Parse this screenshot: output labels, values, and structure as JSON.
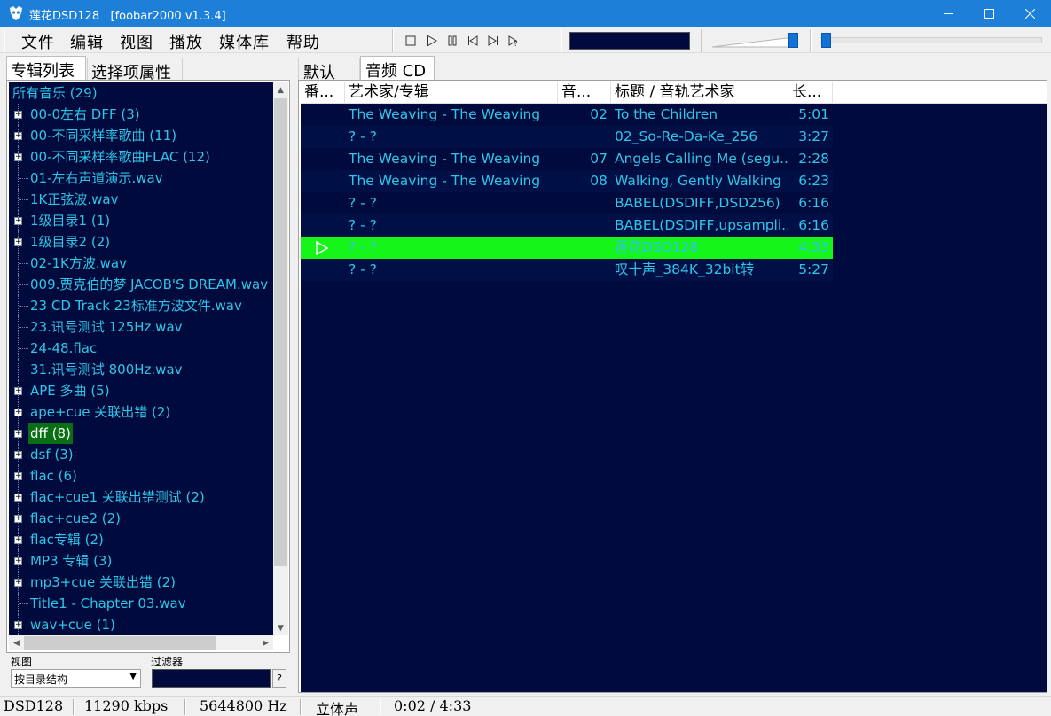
{
  "window": {
    "app_name": "莲花DSD128",
    "app_version": "[foobar2000 v1.3.4]",
    "colors": {
      "titlebar": "#1e7fd9",
      "panel_bg": "#000a3c",
      "text": "#2ec5e8",
      "playing_row": "#16f51a",
      "selected_tree": "#0a6e14"
    }
  },
  "menu": {
    "items": [
      "文件",
      "编辑",
      "视图",
      "播放",
      "媒体库",
      "帮助"
    ]
  },
  "toolbar": {
    "buttons": [
      "stop-icon",
      "play-icon",
      "pause-icon",
      "previous-icon",
      "next-icon",
      "random-icon"
    ]
  },
  "volume": {
    "level": 0.9
  },
  "seek": {
    "position": 0.008
  },
  "left_tabs": [
    "专辑列表",
    "选择项属性"
  ],
  "tree": {
    "root": "所有音乐 (29)",
    "items": [
      {
        "label": "00-0左右 DFF (3)",
        "expandable": true
      },
      {
        "label": "00-不同采样率歌曲 (11)",
        "expandable": true
      },
      {
        "label": "00-不同采样率歌曲FLAC (12)",
        "expandable": true
      },
      {
        "label": "01-左右声道演示.wav",
        "expandable": false
      },
      {
        "label": "1K正弦波.wav",
        "expandable": false
      },
      {
        "label": "1级目录1 (1)",
        "expandable": true
      },
      {
        "label": "1级目录2 (2)",
        "expandable": true
      },
      {
        "label": "02-1K方波.wav",
        "expandable": false
      },
      {
        "label": "009.贾克伯的梦 JACOB'S DREAM.wav",
        "expandable": false
      },
      {
        "label": "23 CD Track 23标准方波文件.wav",
        "expandable": false
      },
      {
        "label": "23.讯号测试 125Hz.wav",
        "expandable": false
      },
      {
        "label": "24-48.flac",
        "expandable": false
      },
      {
        "label": "31.讯号测试 800Hz.wav",
        "expandable": false
      },
      {
        "label": "APE 多曲 (5)",
        "expandable": true
      },
      {
        "label": "ape+cue 关联出错 (2)",
        "expandable": true
      },
      {
        "label": "dff (8)",
        "expandable": true,
        "selected": true
      },
      {
        "label": "dsf (3)",
        "expandable": true
      },
      {
        "label": "flac (6)",
        "expandable": true
      },
      {
        "label": "flac+cue1 关联出错测试 (2)",
        "expandable": true
      },
      {
        "label": "flac+cue2 (2)",
        "expandable": true
      },
      {
        "label": "flac专辑 (2)",
        "expandable": true
      },
      {
        "label": "MP3 专辑 (3)",
        "expandable": true
      },
      {
        "label": "mp3+cue 关联出错 (2)",
        "expandable": true
      },
      {
        "label": "Title1 - Chapter 03.wav",
        "expandable": false
      },
      {
        "label": "wav+cue (1)",
        "expandable": true
      }
    ]
  },
  "view": {
    "label": "视图",
    "selected": "按目录结构"
  },
  "filter": {
    "label": "过滤器",
    "help": "?"
  },
  "right_tabs": [
    "默认",
    "音频 CD"
  ],
  "playlist": {
    "columns": [
      "番...",
      "艺术家/专辑",
      "音...",
      "标题 / 音轨艺术家",
      "长..."
    ],
    "rows": [
      {
        "artist_album": "The Weaving - The Weaving",
        "track": "02",
        "title": "To the Children",
        "length": "5:01"
      },
      {
        "artist_album": "? - ?",
        "track": "",
        "title": "02_So-Re-Da-Ke_256",
        "length": "3:27"
      },
      {
        "artist_album": "The Weaving - The Weaving",
        "track": "07",
        "title": "Angels Calling Me (segu...",
        "length": "2:28"
      },
      {
        "artist_album": "The Weaving - The Weaving",
        "track": "08",
        "title": "Walking, Gently Walking",
        "length": "6:23"
      },
      {
        "artist_album": "? - ?",
        "track": "",
        "title": "BABEL(DSDIFF,DSD256)",
        "length": "6:16"
      },
      {
        "artist_album": "? - ?",
        "track": "",
        "title": "BABEL(DSDIFF,upsampli...",
        "length": "6:16"
      },
      {
        "artist_album": "? - ?",
        "track": "",
        "title": "莲花DSD128",
        "length": "4:33",
        "playing": true
      },
      {
        "artist_album": "? - ?",
        "track": "",
        "title": "叹十声_384K_32bit转",
        "length": "5:27"
      }
    ]
  },
  "status": {
    "format": "DSD128",
    "bitrate": "11290 kbps",
    "samplerate": "5644800 Hz",
    "channels": "立体声",
    "time": "0:02 / 4:33"
  }
}
